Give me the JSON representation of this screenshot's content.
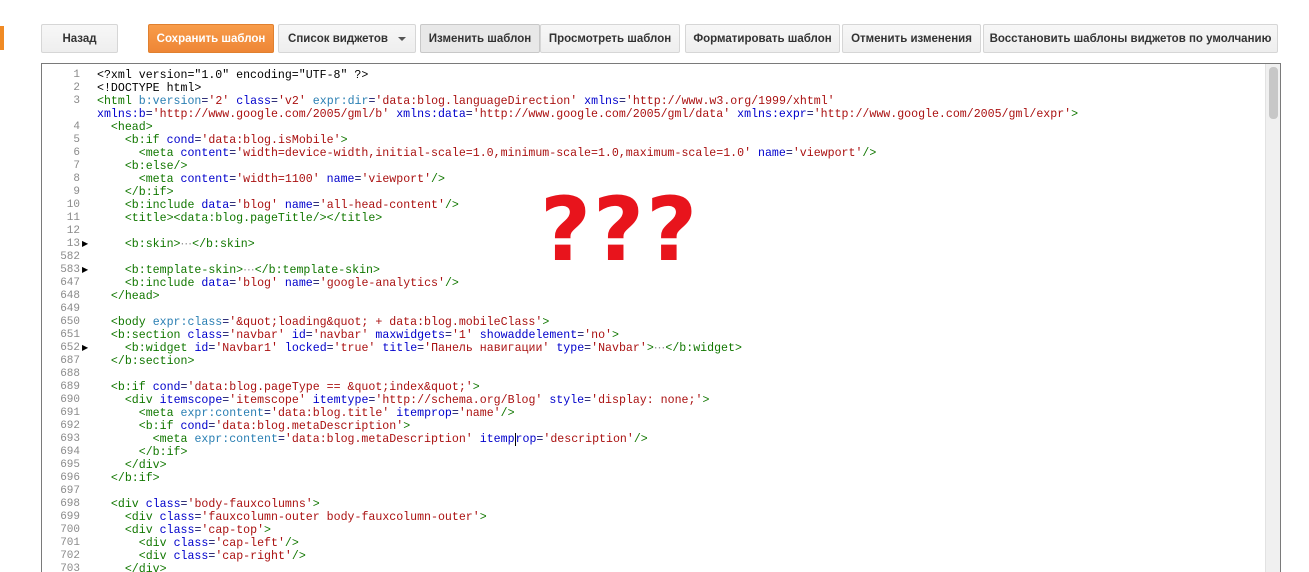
{
  "toolbar": {
    "back": "Назад",
    "save": "Сохранить шаблон",
    "widgets": "Список виджетов",
    "edit": "Изменить шаблон",
    "preview": "Просмотреть шаблон",
    "format": "Форматировать шаблон",
    "revert": "Отменить изменения",
    "restore": "Восстановить шаблоны виджетов по умолчанию"
  },
  "overlay_text": "???",
  "editor": {
    "lines": [
      {
        "n": "1"
      },
      {
        "n": "2"
      },
      {
        "n": "3"
      },
      {
        "n": ""
      },
      {
        "n": "4"
      },
      {
        "n": "5"
      },
      {
        "n": "6"
      },
      {
        "n": "7"
      },
      {
        "n": "8"
      },
      {
        "n": "9"
      },
      {
        "n": "10"
      },
      {
        "n": "11"
      },
      {
        "n": "12"
      },
      {
        "n": "13"
      },
      {
        "n": "582"
      },
      {
        "n": "583"
      },
      {
        "n": "647"
      },
      {
        "n": "648"
      },
      {
        "n": "649"
      },
      {
        "n": "650"
      },
      {
        "n": "651"
      },
      {
        "n": "652"
      },
      {
        "n": "687"
      },
      {
        "n": "688"
      },
      {
        "n": "689"
      },
      {
        "n": "690"
      },
      {
        "n": "691"
      },
      {
        "n": "692"
      },
      {
        "n": "693"
      },
      {
        "n": "694"
      },
      {
        "n": "695"
      },
      {
        "n": "696"
      },
      {
        "n": "697"
      },
      {
        "n": "698"
      },
      {
        "n": "699"
      },
      {
        "n": "700"
      },
      {
        "n": "701"
      },
      {
        "n": "702"
      },
      {
        "n": "703"
      }
    ]
  },
  "colors": {
    "primary_button": "#f08a24",
    "overlay": "#e8141c"
  },
  "icons": {
    "fold_marker": "triangle-right-icon",
    "dropdown": "caret-down-icon"
  }
}
